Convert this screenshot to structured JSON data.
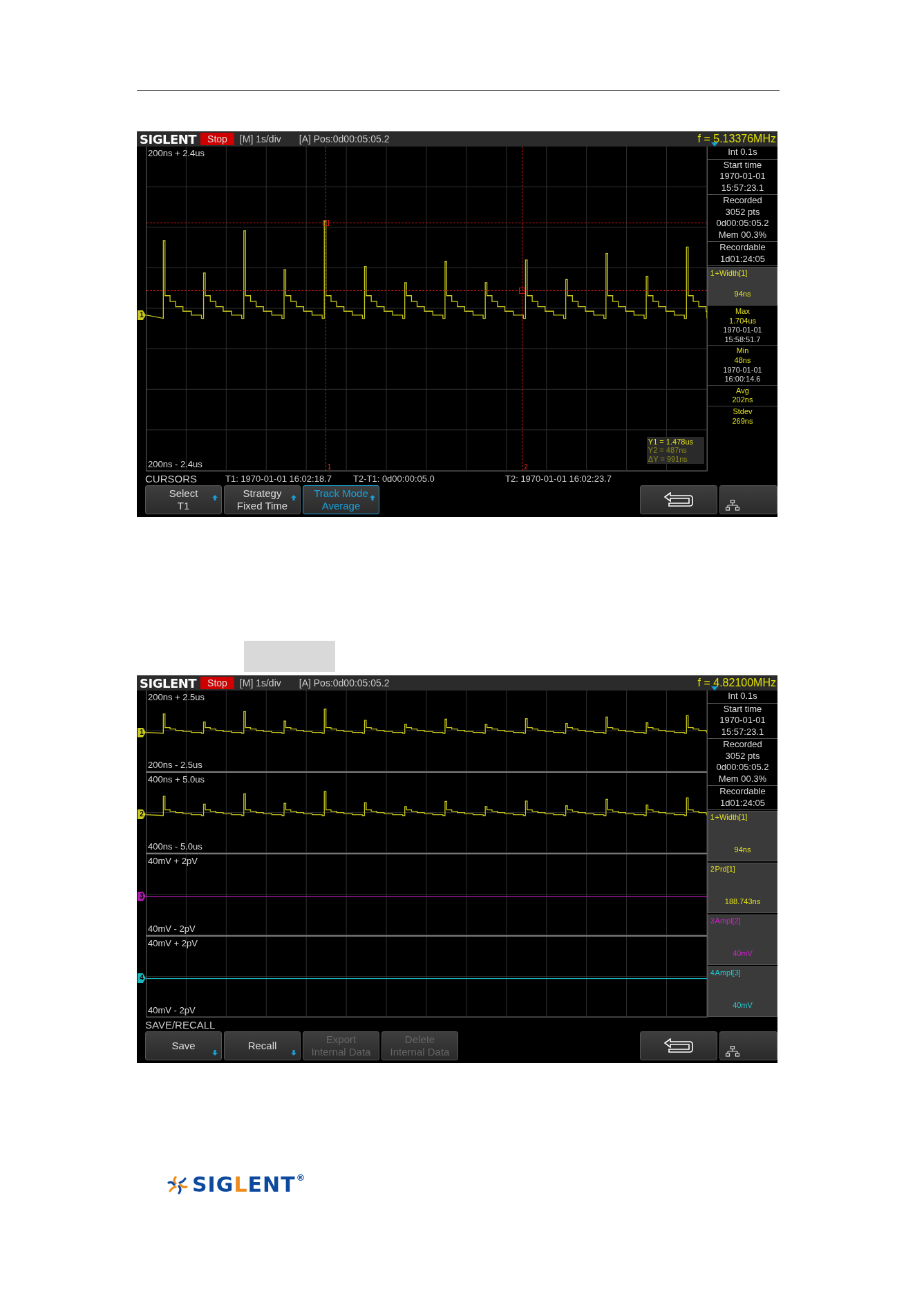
{
  "screens": [
    {
      "header": {
        "brand": "SIGLENT",
        "run_state": "Stop",
        "timebase": "[M] 1s/div",
        "position": "[A] Pos:0d00:05:05.2",
        "frequency": "f = 5.13376MHz"
      },
      "panes": [
        {
          "top_label": "200ns + 2.4us",
          "bottom_label": "200ns - 2.4us",
          "trace": {
            "channel": "1",
            "kind": "pulse",
            "color": "#c8c81e"
          }
        }
      ],
      "cursors": {
        "markers": [
          "1",
          "2"
        ],
        "readout": [
          {
            "text": "Y1 = 1.478us",
            "selected": true
          },
          {
            "text": "Y2 = 487ns",
            "selected": false
          },
          {
            "text": "ΔY = 991ns",
            "selected": false
          }
        ]
      },
      "info": [
        {
          "lines": [
            "Int 0.1s"
          ]
        },
        {
          "lines": [
            "Start time",
            "1970-01-01",
            "15:57:23.1"
          ]
        },
        {
          "lines": [
            "Recorded",
            "3052 pts",
            "0d00:05:05.2",
            "Mem 00.3%"
          ]
        },
        {
          "lines": [
            "Recordable",
            "1d01:24:05"
          ]
        }
      ],
      "measurements": [
        {
          "source": "1",
          "name": "+Width[1]",
          "value": "94ns",
          "color": "#e0e020"
        }
      ],
      "statistics": [
        {
          "label": "Max",
          "value": "1.704us",
          "lines": [
            "1970-01-01",
            "15:58:51.7"
          ]
        },
        {
          "label": "Min",
          "value": "48ns",
          "lines": [
            "1970-01-01",
            "16:00:14.6"
          ]
        },
        {
          "label": "Avg",
          "value": "202ns"
        },
        {
          "label": "Stdev",
          "value": "269ns"
        }
      ],
      "status": {
        "menu": "CURSORS",
        "items": [
          "T1: 1970-01-01 16:02:18.7",
          "T2-T1: 0d00:00:05.0",
          "T2: 1970-01-01 16:02:23.7"
        ]
      },
      "softkeys": [
        {
          "lines": [
            "Select",
            "T1"
          ],
          "kind": "up",
          "selected": false,
          "disabled": false
        },
        {
          "lines": [
            "Strategy",
            "Fixed Time"
          ],
          "kind": "up",
          "selected": false,
          "disabled": false
        },
        {
          "lines": [
            "Track Mode",
            "Average"
          ],
          "kind": "up",
          "selected": true,
          "disabled": false
        }
      ]
    },
    {
      "header": {
        "brand": "SIGLENT",
        "run_state": "Stop",
        "timebase": "[M] 1s/div",
        "position": "[A] Pos:0d00:05:05.2",
        "frequency": "f = 4.82100MHz"
      },
      "panes": [
        {
          "top_label": "200ns + 2.5us",
          "bottom_label": "200ns - 2.5us",
          "trace": {
            "channel": "1",
            "kind": "pulse",
            "color": "#c8c81e"
          }
        },
        {
          "top_label": "400ns + 5.0us",
          "bottom_label": "400ns - 5.0us",
          "trace": {
            "channel": "2",
            "kind": "pulse",
            "color": "#c8c81e"
          }
        },
        {
          "top_label": "40mV + 2pV",
          "bottom_label": "40mV - 2pV",
          "trace": {
            "channel": "3",
            "kind": "flat",
            "color": "#b01cb0"
          }
        },
        {
          "top_label": "40mV + 2pV",
          "bottom_label": "40mV - 2pV",
          "trace": {
            "channel": "4",
            "kind": "flat",
            "color": "#18b8c0"
          }
        }
      ],
      "info": [
        {
          "lines": [
            "Int 0.1s"
          ]
        },
        {
          "lines": [
            "Start time",
            "1970-01-01",
            "15:57:23.1"
          ]
        },
        {
          "lines": [
            "Recorded",
            "3052 pts",
            "0d00:05:05.2",
            "Mem 00.3%"
          ]
        },
        {
          "lines": [
            "Recordable",
            "1d01:24:05"
          ]
        }
      ],
      "measurements": [
        {
          "source": "1",
          "name": "+Width[1]",
          "value": "94ns",
          "color": "#e0e020"
        },
        {
          "source": "2",
          "name": "Prd[1]",
          "value": "188.743ns",
          "color": "#e0e020"
        },
        {
          "source": "3",
          "name": "Ampl[2]",
          "value": "40mV",
          "color": "#d020d0"
        },
        {
          "source": "4",
          "name": "Ampl[3]",
          "value": "40mV",
          "color": "#20c8d0"
        }
      ],
      "status": {
        "menu": "SAVE/RECALL"
      },
      "softkeys": [
        {
          "lines": [
            "Save"
          ],
          "kind": "down",
          "selected": false,
          "disabled": false
        },
        {
          "lines": [
            "Recall"
          ],
          "kind": "down",
          "selected": false,
          "disabled": false
        },
        {
          "lines": [
            "Export",
            "Internal Data"
          ],
          "kind": "plain",
          "selected": false,
          "disabled": true
        },
        {
          "lines": [
            "Delete",
            "Internal Data"
          ],
          "kind": "plain",
          "selected": false,
          "disabled": true
        }
      ]
    }
  ],
  "footer_logo": {
    "parts": [
      {
        "text": "SIG",
        "color": "#0d4a9e"
      },
      {
        "text": "L",
        "color": "#f08c1e"
      },
      {
        "text": "ENT",
        "color": "#0d4a9e"
      }
    ],
    "registered": "®"
  }
}
